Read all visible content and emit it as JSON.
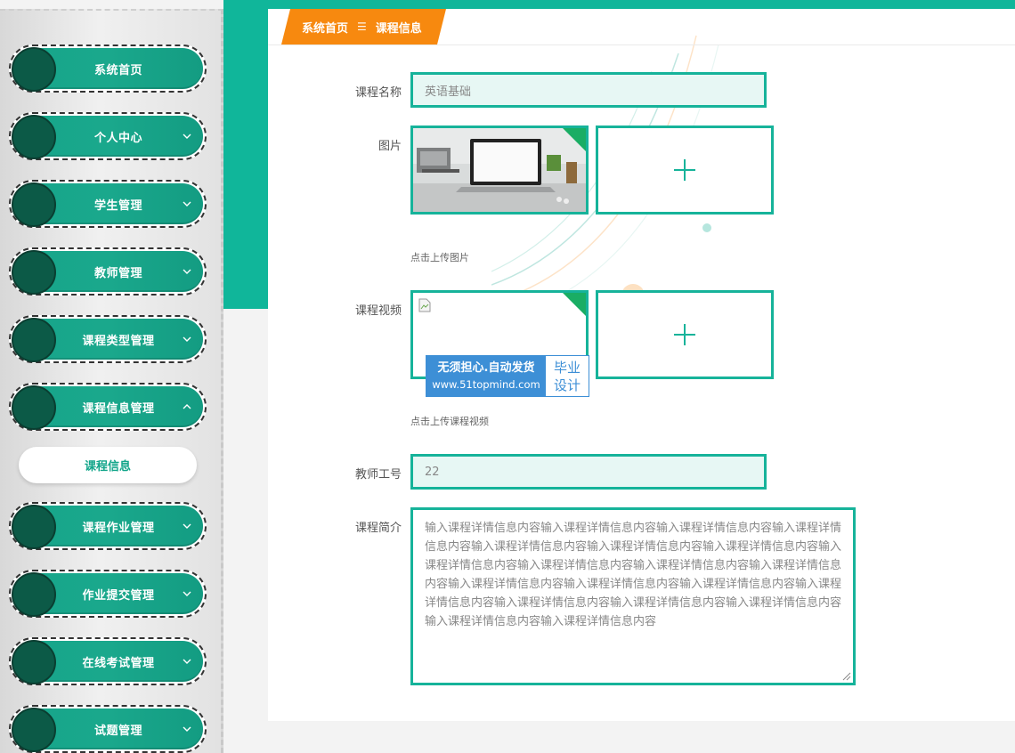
{
  "breadcrumb": {
    "home": "系统首页",
    "separator": "☰",
    "current": "课程信息"
  },
  "sidebar": {
    "items": [
      {
        "label": "系统首页",
        "has_chevron": false
      },
      {
        "label": "个人中心",
        "has_chevron": true
      },
      {
        "label": "学生管理",
        "has_chevron": true
      },
      {
        "label": "教师管理",
        "has_chevron": true
      },
      {
        "label": "课程类型管理",
        "has_chevron": true
      },
      {
        "label": "课程信息管理",
        "has_chevron": true,
        "expanded": true
      },
      {
        "label": "课程作业管理",
        "has_chevron": true
      },
      {
        "label": "作业提交管理",
        "has_chevron": true
      },
      {
        "label": "在线考试管理",
        "has_chevron": true
      },
      {
        "label": "试题管理",
        "has_chevron": true
      }
    ],
    "sub_item": {
      "label": "课程信息"
    }
  },
  "form": {
    "course_name": {
      "label": "课程名称",
      "value": "英语基础"
    },
    "image": {
      "label": "图片",
      "hint": "点击上传图片"
    },
    "video": {
      "label": "课程视频",
      "hint": "点击上传课程视频"
    },
    "teacher_id": {
      "label": "教师工号",
      "value": "22"
    },
    "intro": {
      "label": "课程简介",
      "value": "输入课程详情信息内容输入课程详情信息内容输入课程详情信息内容输入课程详情信息内容输入课程详情信息内容输入课程详情信息内容输入课程详情信息内容输入课程详情信息内容输入课程详情信息内容输入课程详情信息内容输入课程详情信息内容输入课程详情信息内容输入课程详情信息内容输入课程详情信息内容输入课程详情信息内容输入课程详情信息内容输入课程详情信息内容输入课程详情信息内容输入课程详情信息内容输入课程详情信息内容"
    }
  },
  "watermark": {
    "line1": "无须担心.自动发货",
    "line2": "www.51topmind.com",
    "right_line1": "毕业",
    "right_line2": "设计"
  },
  "icons": {
    "chevron": "chevron-down-icon",
    "chevron_expanded": "chevron-up-icon",
    "upload": "plus-icon",
    "broken_image": "broken-image-icon"
  },
  "colors": {
    "primary": "#16b39a",
    "menu_pill": "#16a58a",
    "menu_ball": "#0c5a47",
    "breadcrumb": "#f7890f",
    "input_bg": "#e7f7f4",
    "corner_badge": "#1aad64"
  }
}
